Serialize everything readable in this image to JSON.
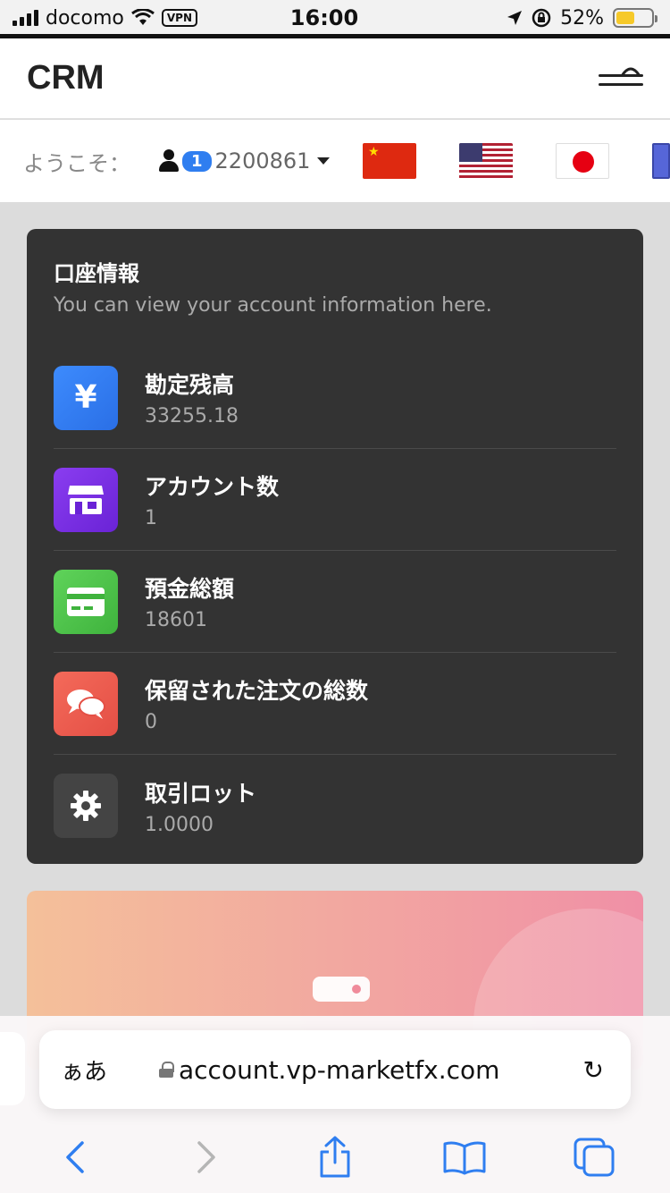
{
  "status_bar": {
    "carrier": "docomo",
    "vpn": "VPN",
    "time": "16:00",
    "battery_percent": "52%",
    "battery_level": 0.52
  },
  "header": {
    "brand": "CRM"
  },
  "welcome": {
    "label": "ようこそ：",
    "badge": "1",
    "user_id": "2200861"
  },
  "account_card": {
    "title": "口座情報",
    "subtitle": "You can view your account information here.",
    "rows": [
      {
        "label": "勘定残高",
        "value": "33255.18",
        "icon": "yen-icon",
        "icon_glyph": "¥",
        "color": "#2f7ef0"
      },
      {
        "label": "アカウント数",
        "value": "1",
        "icon": "store-icon",
        "color": "#7b2ee8"
      },
      {
        "label": "預金総額",
        "value": "18601",
        "icon": "credit-card-icon",
        "color": "#4cc44a"
      },
      {
        "label": "保留された注文の総数",
        "value": "0",
        "icon": "chat-bubbles-icon",
        "color": "#ef5a4d"
      },
      {
        "label": "取引ロット",
        "value": "1.0000",
        "icon": "gear-icon",
        "color": "#444444"
      }
    ]
  },
  "browser": {
    "reader_label": "ぁあ",
    "url": "account.vp-marketfx.com"
  }
}
